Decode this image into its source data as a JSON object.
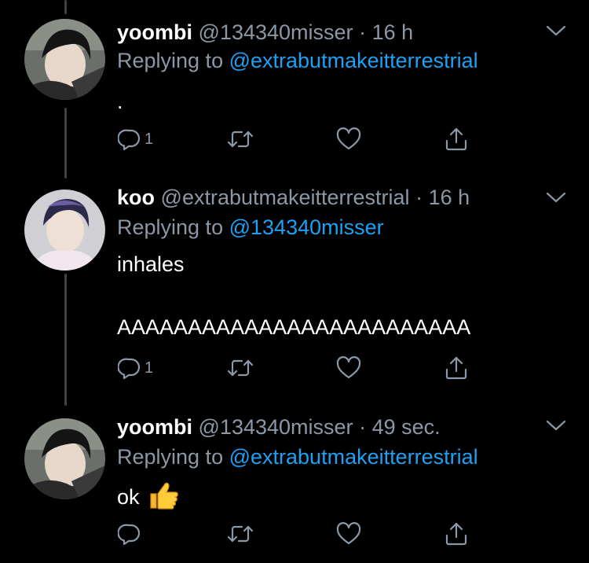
{
  "colors": {
    "background": "#000000",
    "primary_text": "#ffffff",
    "secondary_text": "#8b98a5",
    "link": "#1da1f2",
    "thread_line": "#3d4247"
  },
  "tweets": [
    {
      "display_name": "yoombi",
      "handle": "@134340misser",
      "separator": "·",
      "time": "16 h",
      "replying_prefix": "Replying to",
      "replying_to": "@extrabutmakeitterrestrial",
      "text_lines": [
        "."
      ],
      "reply_count": "1",
      "icons": [
        "reply-icon",
        "retweet-icon",
        "like-icon",
        "share-icon",
        "chevron-down-icon"
      ]
    },
    {
      "display_name": "koo",
      "handle": "@extrabutmakeitterrestrial",
      "separator": "·",
      "time": "16 h",
      "replying_prefix": "Replying to",
      "replying_to": "@134340misser",
      "text_lines": [
        "inhales",
        "AAAAAAAAAAAAAAAAAAAAAAAAA"
      ],
      "reply_count": "1",
      "icons": [
        "reply-icon",
        "retweet-icon",
        "like-icon",
        "share-icon",
        "chevron-down-icon"
      ]
    },
    {
      "display_name": "yoombi",
      "handle": "@134340misser",
      "separator": "·",
      "time": "49 sec.",
      "replying_prefix": "Replying to",
      "replying_to": "@extrabutmakeitterrestrial",
      "text_lines": [
        "ok"
      ],
      "emoji": "thumbs-up-emoji",
      "reply_count": "",
      "icons": [
        "reply-icon",
        "retweet-icon",
        "like-icon",
        "share-icon",
        "chevron-down-icon"
      ]
    }
  ]
}
